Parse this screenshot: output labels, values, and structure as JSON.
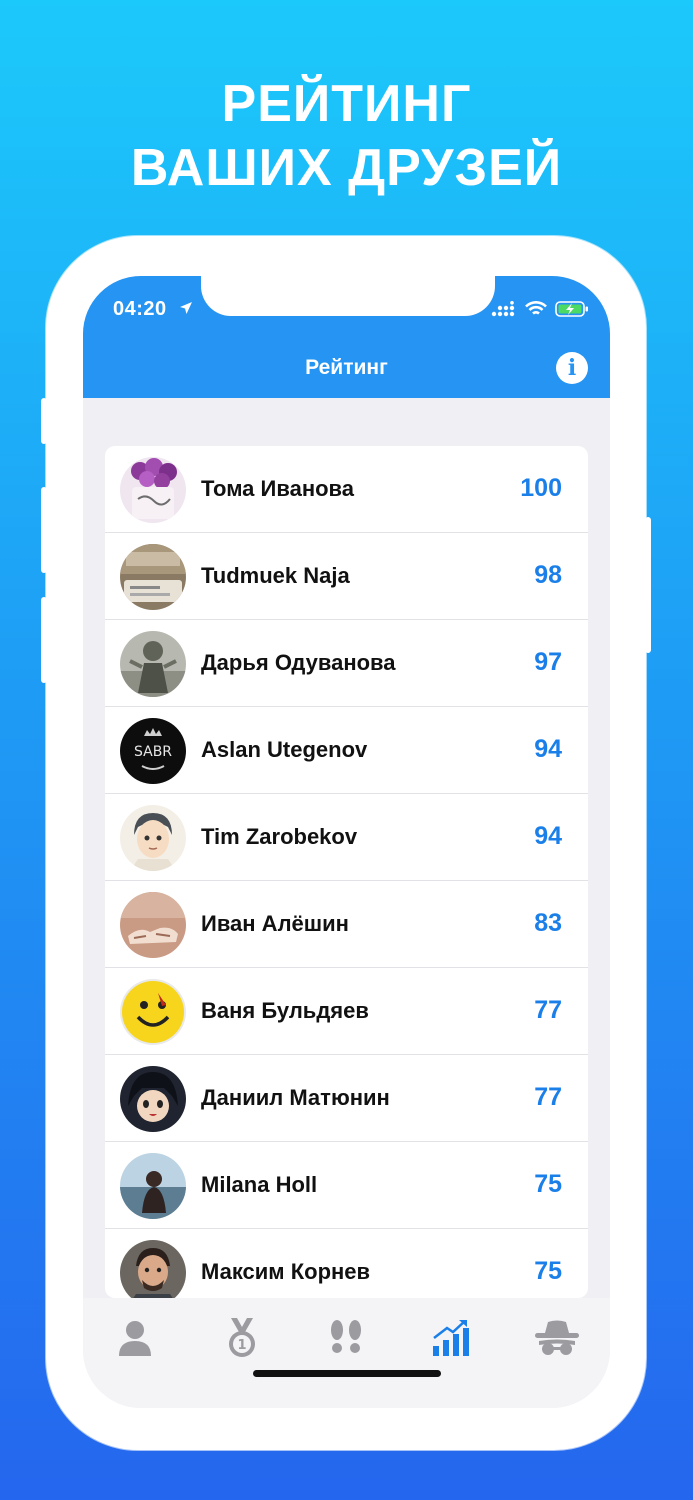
{
  "promo": {
    "line1": "РЕЙТИНГ",
    "line2": "ВАШИХ ДРУЗЕЙ"
  },
  "status_bar": {
    "time": "04:20"
  },
  "nav": {
    "title": "Рейтинг",
    "info_label": "i"
  },
  "colors": {
    "accent": "#2694f2",
    "score": "#1a7fe8",
    "tab_inactive": "#9b9ba0"
  },
  "rating": [
    {
      "name": "Тома Иванова",
      "score": "100"
    },
    {
      "name": "Tudmuek Naja",
      "score": "98"
    },
    {
      "name": "Дарья Одуванова",
      "score": "97"
    },
    {
      "name": "Aslan Utegenov",
      "score": "94"
    },
    {
      "name": "Tim Zarobekov",
      "score": "94"
    },
    {
      "name": "Иван Алёшин",
      "score": "83"
    },
    {
      "name": "Ваня Бульдяев",
      "score": "77"
    },
    {
      "name": "Даниил Матюнин",
      "score": "77"
    },
    {
      "name": "Milana Holl",
      "score": "75"
    },
    {
      "name": "Максим Корнев",
      "score": "75"
    }
  ],
  "tabs": [
    {
      "icon": "person-icon",
      "active": false
    },
    {
      "icon": "medal-icon",
      "active": false
    },
    {
      "icon": "footprints-icon",
      "active": false
    },
    {
      "icon": "rating-chart-icon",
      "active": true
    },
    {
      "icon": "incognito-icon",
      "active": false
    }
  ]
}
